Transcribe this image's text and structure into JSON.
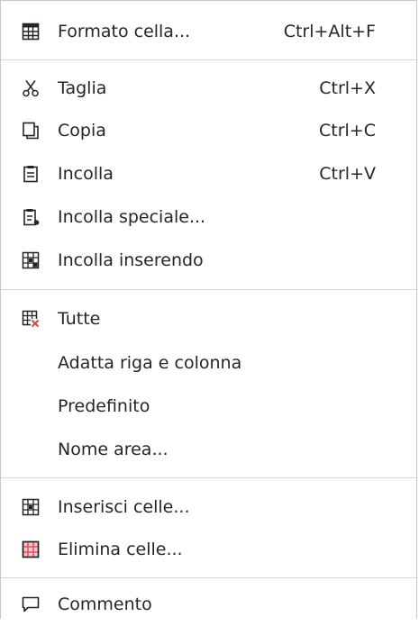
{
  "menu": {
    "items": [
      {
        "label": "Formato cella...",
        "shortcut": "Ctrl+Alt+F",
        "icon": "table-grid-icon"
      },
      {
        "label": "Taglia",
        "shortcut": "Ctrl+X",
        "icon": "scissors-icon"
      },
      {
        "label": "Copia",
        "shortcut": "Ctrl+C",
        "icon": "copy-icon"
      },
      {
        "label": "Incolla",
        "shortcut": "Ctrl+V",
        "icon": "clipboard-icon"
      },
      {
        "label": "Incolla speciale...",
        "shortcut": "",
        "icon": "paste-special-icon"
      },
      {
        "label": "Incolla inserendo",
        "shortcut": "",
        "icon": "paste-insert-icon"
      },
      {
        "label": "Tutte",
        "shortcut": "",
        "icon": "clear-cells-icon"
      },
      {
        "label": "Adatta riga e colonna",
        "shortcut": "",
        "icon": ""
      },
      {
        "label": "Predefinito",
        "shortcut": "",
        "icon": ""
      },
      {
        "label": "Nome area...",
        "shortcut": "",
        "icon": ""
      },
      {
        "label": "Inserisci celle...",
        "shortcut": "",
        "icon": "insert-cells-icon"
      },
      {
        "label": "Elimina celle...",
        "shortcut": "",
        "icon": "delete-cells-icon"
      },
      {
        "label": "Commento",
        "shortcut": "",
        "icon": "comment-icon"
      }
    ]
  },
  "colors": {
    "text": "#232629",
    "separator": "#d5d7d9",
    "delete_accent": "#da4453"
  }
}
